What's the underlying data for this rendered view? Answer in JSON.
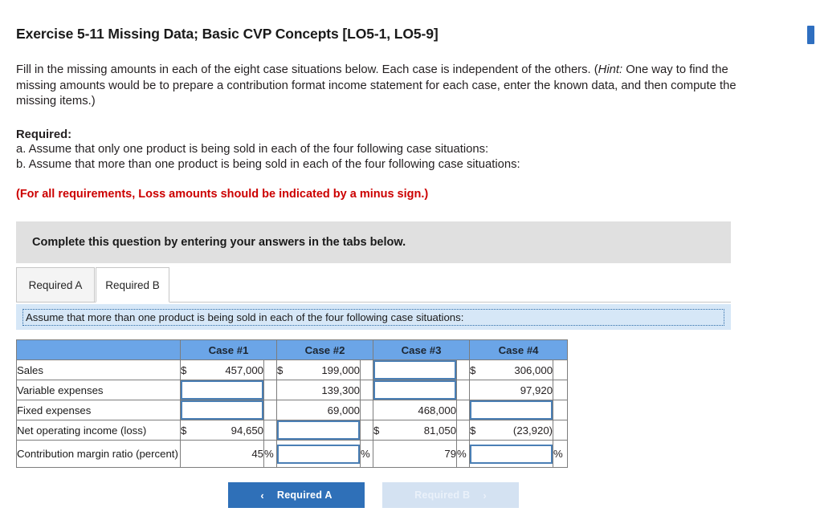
{
  "title": "Exercise 5-11 Missing Data; Basic CVP Concepts [LO5-1, LO5-9]",
  "intro": {
    "part1": "Fill in the missing amounts in each of the eight case situations below. Each case is independent of the others. (",
    "hint_label": "Hint:",
    "part2": " One way to find the missing amounts would be to prepare a contribution format income statement for each case, enter the known data, and then compute the missing items.)"
  },
  "required": {
    "heading": "Required:",
    "item_a": "a. Assume that only one product is being sold in each of the four following case situations:",
    "item_b": "b. Assume that more than one product is being sold in each of the four following case situations:"
  },
  "loss_note": "(For all requirements, Loss amounts should be indicated by a minus sign.)",
  "instruction_bar": "Complete this question by entering your answers in the tabs below.",
  "tabs": [
    {
      "label": "Required A",
      "active": false
    },
    {
      "label": "Required B",
      "active": true
    }
  ],
  "assume_bar": "Assume that more than one product is being sold in each of the four following case situations:",
  "table": {
    "columns": [
      "",
      "Case #1",
      "Case #2",
      "Case #3",
      "Case #4"
    ],
    "rows": [
      {
        "label": "Sales",
        "cells": [
          {
            "type": "value",
            "currency": "$",
            "value": "457,000",
            "suffix": ""
          },
          {
            "type": "value",
            "currency": "$",
            "value": "199,000",
            "suffix": ""
          },
          {
            "type": "input",
            "value": "",
            "suffix": ""
          },
          {
            "type": "value",
            "currency": "$",
            "value": "306,000",
            "suffix": ""
          }
        ]
      },
      {
        "label": "Variable expenses",
        "cells": [
          {
            "type": "input",
            "value": "",
            "suffix": ""
          },
          {
            "type": "value",
            "currency": "",
            "value": "139,300",
            "suffix": ""
          },
          {
            "type": "input",
            "value": "",
            "suffix": ""
          },
          {
            "type": "value",
            "currency": "",
            "value": "97,920",
            "suffix": ""
          }
        ]
      },
      {
        "label": "Fixed expenses",
        "cells": [
          {
            "type": "input",
            "value": "",
            "suffix": ""
          },
          {
            "type": "value",
            "currency": "",
            "value": "69,000",
            "suffix": ""
          },
          {
            "type": "value",
            "currency": "",
            "value": "468,000",
            "suffix": ""
          },
          {
            "type": "input",
            "value": "",
            "suffix": ""
          }
        ]
      },
      {
        "label": "Net operating income (loss)",
        "cells": [
          {
            "type": "value",
            "currency": "$",
            "value": "94,650",
            "suffix": ""
          },
          {
            "type": "input",
            "value": "",
            "suffix": ""
          },
          {
            "type": "value",
            "currency": "$",
            "value": "81,050",
            "suffix": ""
          },
          {
            "type": "value",
            "currency": "$",
            "value": "(23,920)",
            "suffix": ""
          }
        ]
      },
      {
        "label": "Contribution margin ratio (percent)",
        "cells": [
          {
            "type": "value",
            "currency": "",
            "value": "45",
            "suffix": "%"
          },
          {
            "type": "input",
            "value": "",
            "suffix": "%"
          },
          {
            "type": "value",
            "currency": "",
            "value": "79",
            "suffix": "%"
          },
          {
            "type": "input",
            "value": "",
            "suffix": "%"
          }
        ]
      }
    ]
  },
  "nav": {
    "prev": {
      "label": "Required A",
      "chevron": "‹",
      "enabled": true
    },
    "next": {
      "label": "Required B",
      "chevron": "›",
      "enabled": false
    }
  },
  "colors": {
    "header_blue": "#6ba5e7",
    "assume_blue": "#d6e7f7",
    "input_border": "#4a7fb5",
    "primary_button": "#2f70b8",
    "disabled_button": "#d4e2f2",
    "loss_red": "#cc0000",
    "gray_bar": "#e0e0e0",
    "scrollbar": "#2f6fc0"
  }
}
